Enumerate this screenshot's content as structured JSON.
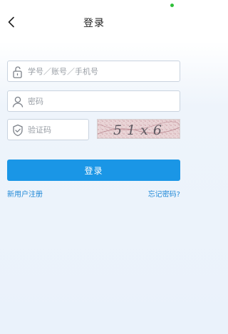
{
  "header": {
    "title": "登录",
    "back_icon": "chevron-left-icon"
  },
  "form": {
    "username": {
      "icon": "lock-open-icon",
      "placeholder": "学号／账号／手机号",
      "value": ""
    },
    "password": {
      "icon": "user-icon",
      "placeholder": "密码",
      "value": ""
    },
    "captcha": {
      "icon": "shield-check-icon",
      "placeholder": "验证码",
      "value": "",
      "image_text": "51x6"
    },
    "login_label": "登录"
  },
  "links": {
    "register": "新用户注册",
    "forgot_password": "忘记密码?"
  },
  "colors": {
    "primary": "#1a96e6",
    "link": "#1f88d7",
    "background": "#eaf2fb",
    "status_dot": "#2fbf3a"
  }
}
